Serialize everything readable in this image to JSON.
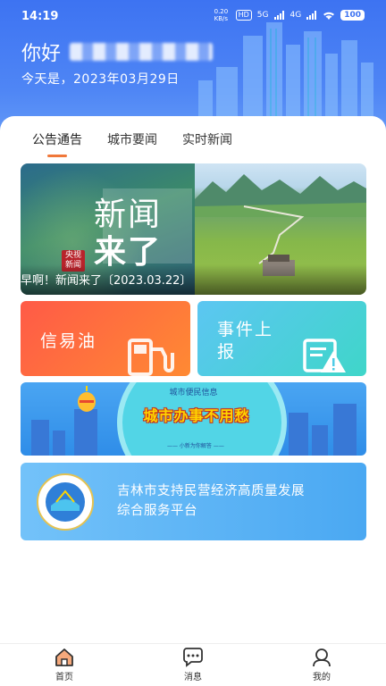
{
  "status_bar": {
    "time": "14:19",
    "speed": "0.20 KB/s",
    "hd": "HD",
    "net1": "5G",
    "net2": "4G",
    "battery": "100"
  },
  "header": {
    "greeting": "你好",
    "date_text": "今天是，2023年03月29日"
  },
  "tabs": [
    {
      "label": "公告通告",
      "active": true
    },
    {
      "label": "城市要闻",
      "active": false
    },
    {
      "label": "实时新闻",
      "active": false
    }
  ],
  "banner": {
    "title_line1": "新闻",
    "title_line2": "来了",
    "channel_badge": "央视\n新闻",
    "caption": "早啊！新闻来了〔2023.03.22〕"
  },
  "tiles": {
    "oil_label": "信易油",
    "report_label": "事件上报"
  },
  "city_banner": {
    "small_title": "城市便民信息",
    "big_title": "城市办事不用愁",
    "subtitle": "—— 小新为你解答 ——"
  },
  "service": {
    "line1": "吉林市支持民营经济高质量发展",
    "line2": "综合服务平台"
  },
  "nav": {
    "home": "首页",
    "message": "消息",
    "mine": "我的"
  },
  "colors": {
    "header_blue": "#3d73f2",
    "tab_accent": "#f0783a",
    "oil_tile": "#ff6a40",
    "report_tile": "#4fcbe6",
    "nav_active": "#f0783a"
  }
}
